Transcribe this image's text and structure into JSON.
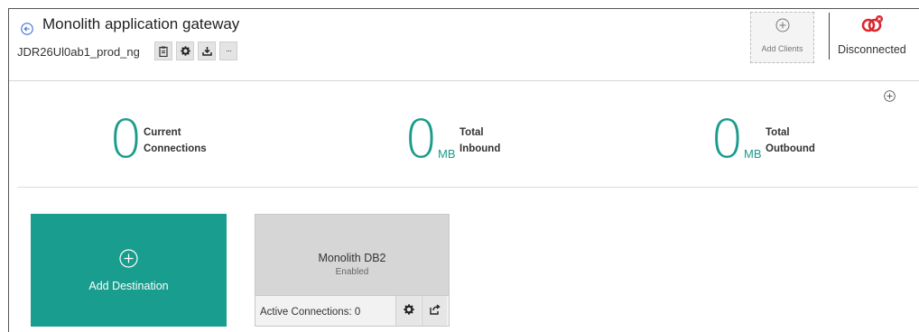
{
  "header": {
    "title": "Monolith application gateway",
    "gateway_id": "JDR26Ul0ab1_prod_ng",
    "toolbar": [
      {
        "icon": "clipboard-icon"
      },
      {
        "icon": "gear-icon"
      },
      {
        "icon": "download-icon"
      },
      {
        "icon": "more-icon",
        "label": "···"
      }
    ],
    "add_clients_label": "Add Clients",
    "connection_status": "Disconnected",
    "connection_icon": "disconnected-chain-icon",
    "accent_color": "#1a9c8c",
    "status_color": "#d9272e"
  },
  "stats": [
    {
      "value": "0",
      "unit": "",
      "label_line1": "Current",
      "label_line2": "Connections"
    },
    {
      "value": "0",
      "unit": "MB",
      "label_line1": "Total",
      "label_line2": "Inbound"
    },
    {
      "value": "0",
      "unit": "MB",
      "label_line1": "Total",
      "label_line2": "Outbound"
    }
  ],
  "add_destination": {
    "label": "Add Destination",
    "color": "#199d8e"
  },
  "destinations": [
    {
      "name": "Monolith DB2",
      "status": "Enabled",
      "active_connections": "Active Connections: 0"
    }
  ]
}
